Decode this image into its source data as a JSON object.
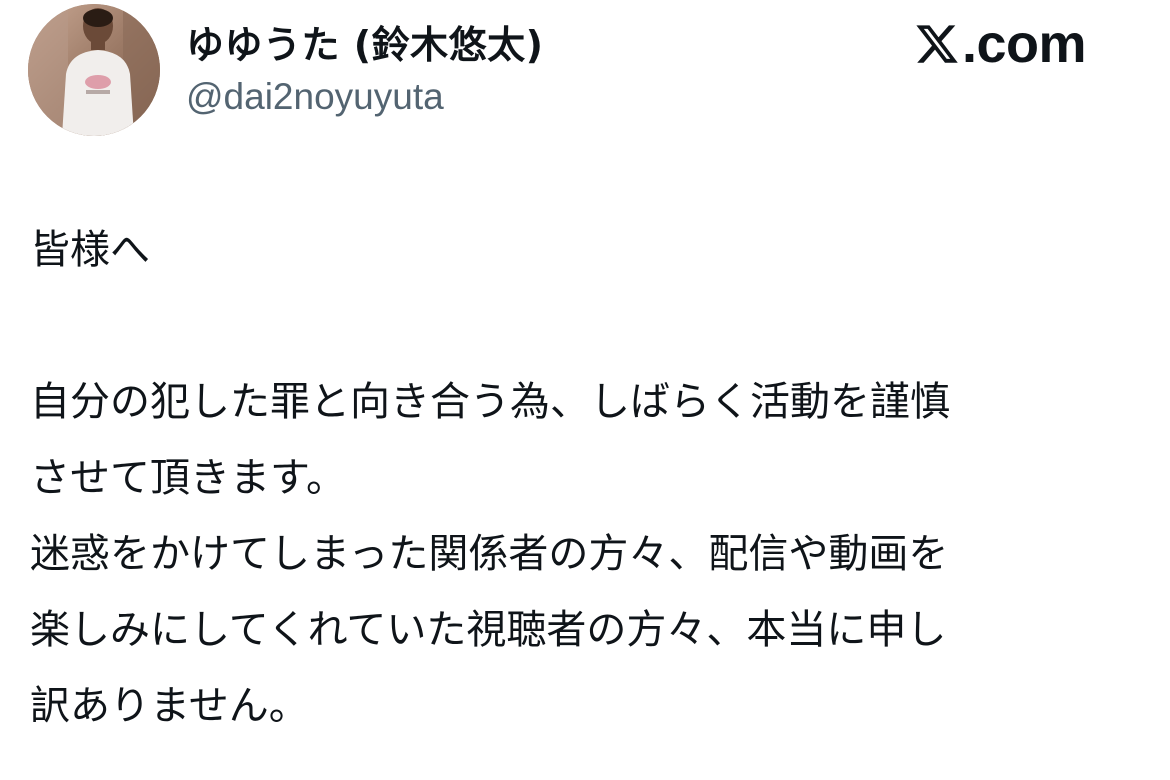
{
  "author": {
    "name": "ゆゆうた (鈴木悠太)",
    "handle": "@dai2noyuyuta",
    "avatar_icon": "profile-photo"
  },
  "brand": {
    "icon": "x-logo-icon",
    "text": ".com"
  },
  "tweet": {
    "lines": [
      "皆様へ",
      "",
      "自分の犯した罪と向き合う為、しばらく活動を謹慎",
      "させて頂きます。",
      "迷惑をかけてしまった関係者の方々、配信や動画を",
      "楽しみにしてくれていた視聴者の方々、本当に申し",
      "訳ありません。"
    ]
  },
  "colors": {
    "text_primary": "#0f1419",
    "text_secondary": "#536471",
    "background": "#ffffff"
  }
}
